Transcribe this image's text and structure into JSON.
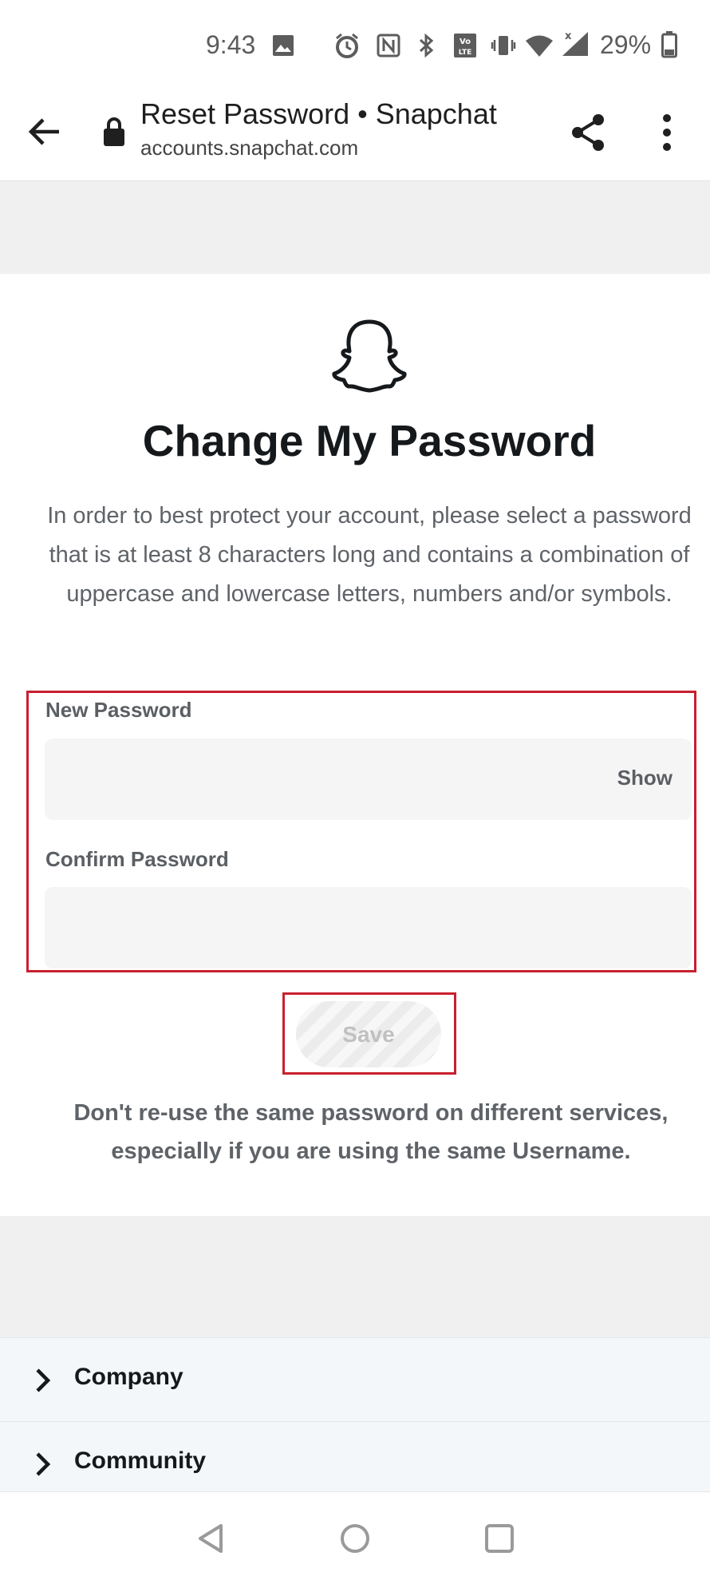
{
  "status_bar": {
    "time": "9:43",
    "battery_percent": "29%",
    "icons": [
      "image-icon",
      "alarm-icon",
      "nfc-icon",
      "bluetooth-icon",
      "volte-icon",
      "vibrate-icon",
      "wifi-icon",
      "signal-icon",
      "battery-icon"
    ]
  },
  "browser": {
    "title": "Reset Password • Snapchat",
    "url": "accounts.snapchat.com"
  },
  "main": {
    "heading": "Change My Password",
    "description": "In order to best protect your account, please select a password that is at least 8 characters long and contains a combination of uppercase and lowercase letters, numbers and/or symbols.",
    "new_password_label": "New Password",
    "new_password_value": "",
    "show_label": "Show",
    "confirm_password_label": "Confirm Password",
    "confirm_password_value": "",
    "save_label": "Save",
    "note": "Don't re-use the same password on different services, especially if you are using the same Username."
  },
  "footer": {
    "items": [
      {
        "label": "Company"
      },
      {
        "label": "Community"
      }
    ]
  },
  "colors": {
    "highlight_border": "#c8202f",
    "footer_bg": "#f4f7fa",
    "band_gray": "#f0f0f0"
  }
}
